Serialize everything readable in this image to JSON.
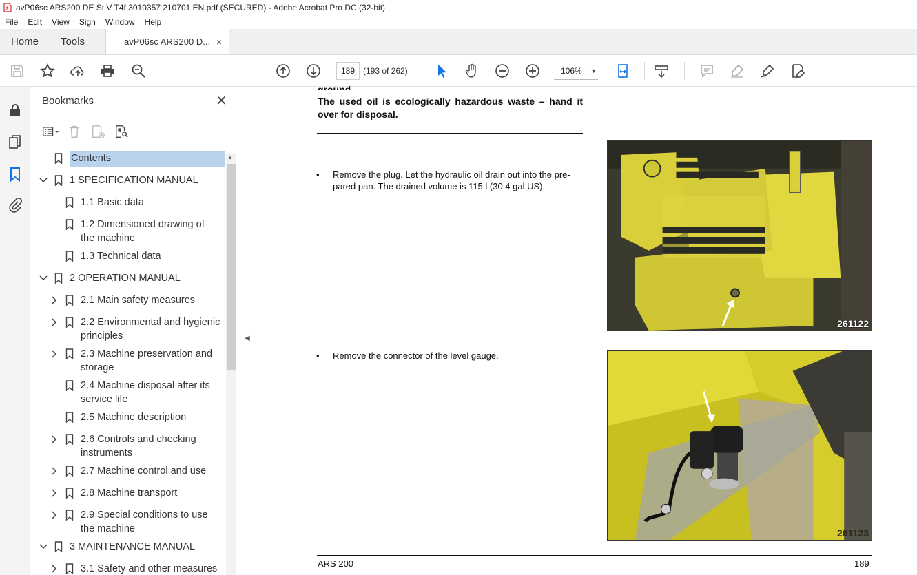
{
  "window": {
    "title": "avP06sc ARS200 DE St V T4f 3010357 210701 EN.pdf (SECURED) - Adobe Acrobat Pro DC (32-bit)"
  },
  "menu": [
    "File",
    "Edit",
    "View",
    "Sign",
    "Window",
    "Help"
  ],
  "tabs": {
    "home": "Home",
    "tools": "Tools",
    "document": "avP06sc ARS200 D...",
    "close": "×"
  },
  "toolbar": {
    "page_input": "189",
    "page_count": "(193 of 262)",
    "zoom": "106%"
  },
  "bookmarks": {
    "title": "Bookmarks",
    "close": "✕",
    "items": [
      {
        "label": "Contents",
        "level": 0,
        "expander": "none",
        "selected": true
      },
      {
        "label": "1 SPECIFICATION MANUAL",
        "level": 0,
        "expander": "open"
      },
      {
        "label": "1.1 Basic data",
        "level": 1,
        "expander": "none"
      },
      {
        "label": "1.2 Dimensioned drawing of the machine",
        "level": 1,
        "expander": "none"
      },
      {
        "label": "1.3 Technical data",
        "level": 1,
        "expander": "none"
      },
      {
        "label": "2 OPERATION MANUAL",
        "level": 0,
        "expander": "open"
      },
      {
        "label": "2.1 Main safety measures",
        "level": 1,
        "expander": "closed"
      },
      {
        "label": "2.2 Environmental and hygienic principles",
        "level": 1,
        "expander": "closed"
      },
      {
        "label": "2.3 Machine preservation and storage",
        "level": 1,
        "expander": "closed"
      },
      {
        "label": "2.4 Machine disposal after its service life",
        "level": 1,
        "expander": "none"
      },
      {
        "label": "2.5 Machine description",
        "level": 1,
        "expander": "none"
      },
      {
        "label": "2.6 Controls and checking instruments",
        "level": 1,
        "expander": "closed"
      },
      {
        "label": "2.7 Machine control and use",
        "level": 1,
        "expander": "closed"
      },
      {
        "label": "2.8 Machine transport",
        "level": 1,
        "expander": "closed"
      },
      {
        "label": "2.9 Special conditions to use the machine",
        "level": 1,
        "expander": "closed"
      },
      {
        "label": "3 MAINTENANCE MANUAL",
        "level": 0,
        "expander": "open"
      },
      {
        "label": "3.1 Safety and other measures",
        "level": 1,
        "expander": "closed"
      }
    ]
  },
  "document": {
    "cut_line": "ground.",
    "warning": "The used oil is ecologically hazardous waste – hand it over for disposal.",
    "steps": [
      {
        "bullet": "•",
        "text": "Remove the plug. Let the hydraulic oil drain out into the pre-pared pan. The drained volume is 115 l (30.4 gal US).",
        "image_number": "261122"
      },
      {
        "bullet": "•",
        "text": "Remove the connector of the level gauge.",
        "image_number": "261123"
      }
    ],
    "footer_left": "ARS 200",
    "footer_right": "189"
  },
  "colors": {
    "accent_blue": "#1473e6",
    "acrobat_red": "#d7282f",
    "machine_yellow": "#e6dc3c"
  }
}
